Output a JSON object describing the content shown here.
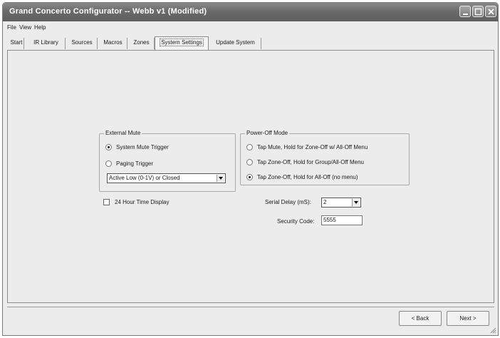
{
  "window": {
    "title": "Grand Concerto Configurator -- Webb v1 (Modified)"
  },
  "menu": {
    "items": [
      "File",
      "View",
      "Help"
    ]
  },
  "tabs": [
    {
      "label": "Start"
    },
    {
      "label": "IR Library"
    },
    {
      "label": "Sources"
    },
    {
      "label": "Macros"
    },
    {
      "label": "Zones"
    },
    {
      "label": "System Settings",
      "active": true
    },
    {
      "label": "Update System"
    }
  ],
  "external_mute": {
    "legend": "External Mute",
    "options": [
      {
        "label": "System Mute Trigger",
        "checked": true
      },
      {
        "label": "Paging Trigger",
        "checked": false
      }
    ],
    "select_value": "Active Low (0-1V) or Closed"
  },
  "time_display": {
    "label": "24 Hour Time Display",
    "checked": false
  },
  "power_off_mode": {
    "legend": "Power-Off Mode",
    "options": [
      {
        "label": "Tap Mute, Hold for Zone-Off w/ All-Off Menu",
        "checked": false
      },
      {
        "label": "Tap Zone-Off, Hold for Group/All-Off Menu",
        "checked": false
      },
      {
        "label": "Tap Zone-Off, Hold for All-Off (no menu)",
        "checked": true
      }
    ]
  },
  "serial_delay": {
    "label": "Serial Delay (mS):",
    "value": "2"
  },
  "security_code": {
    "label": "Security Code:",
    "value": "5555"
  },
  "footer": {
    "back_label": "< Back",
    "next_label": "Next >"
  }
}
